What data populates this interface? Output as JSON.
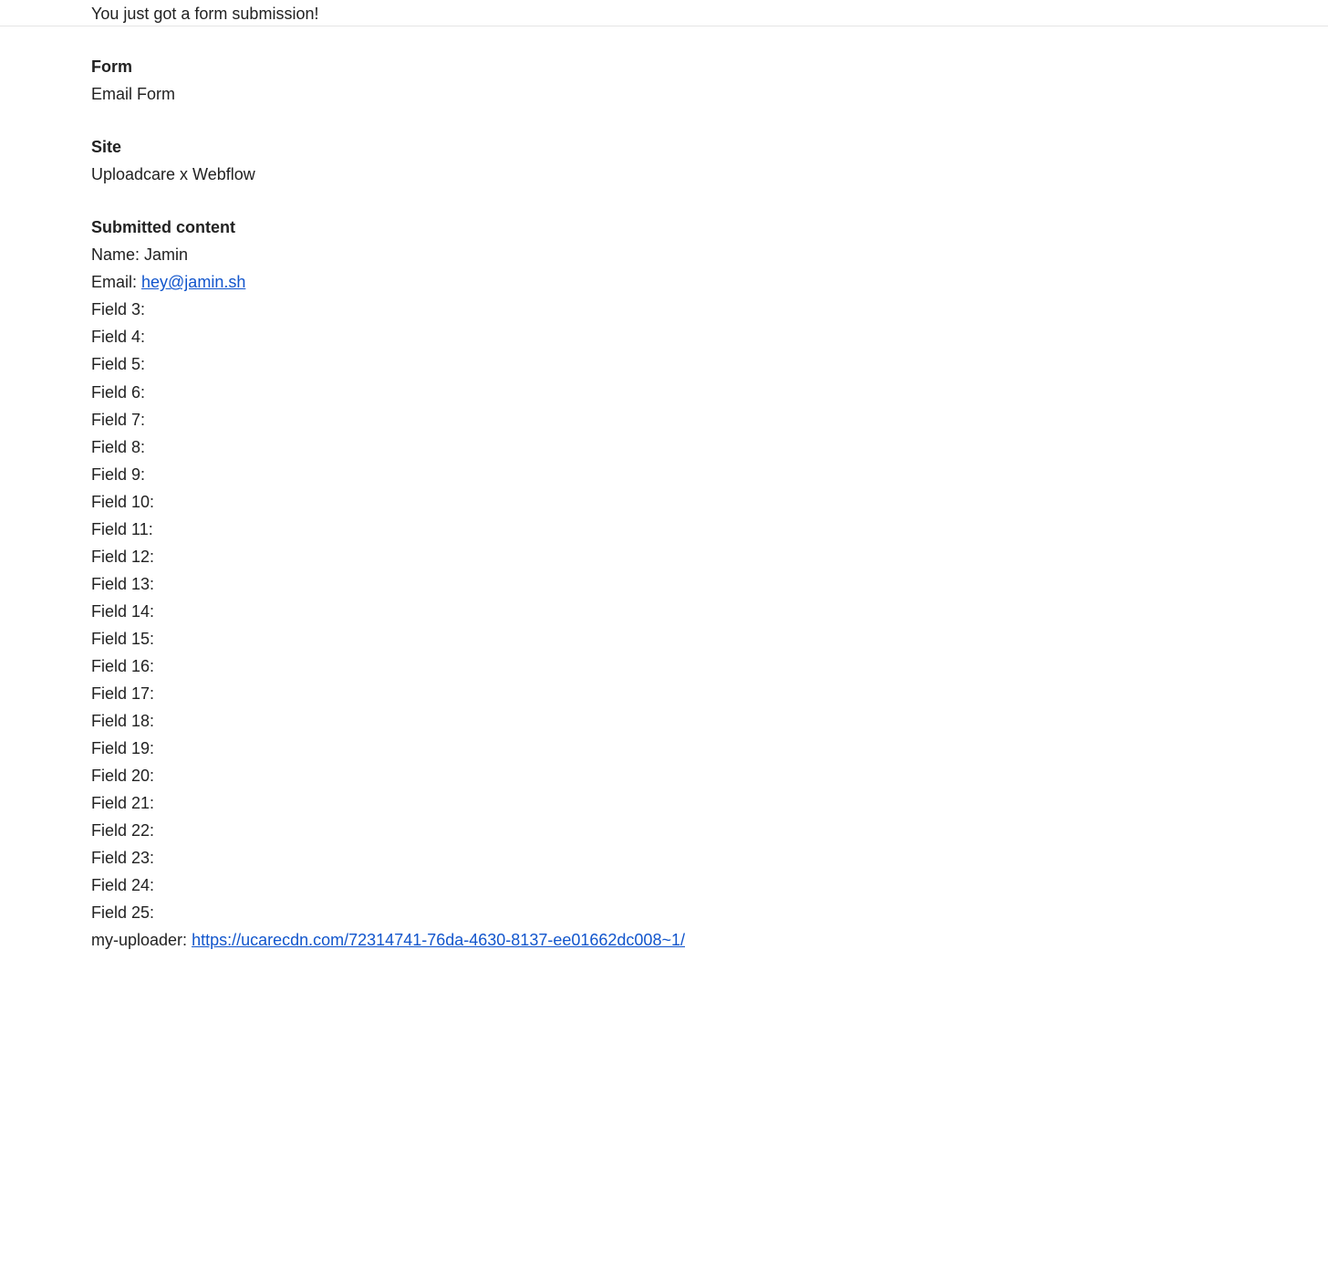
{
  "intro": "You just got a form submission!",
  "form": {
    "heading": "Form",
    "value": "Email Form"
  },
  "site": {
    "heading": "Site",
    "value": "Uploadcare x Webflow"
  },
  "submitted": {
    "heading": "Submitted content",
    "fields": [
      {
        "label": "Name: ",
        "value": "Jamin",
        "is_link": false
      },
      {
        "label": "Email: ",
        "value": "hey@jamin.sh",
        "is_link": true
      },
      {
        "label": "Field 3: ",
        "value": "",
        "is_link": false
      },
      {
        "label": "Field 4: ",
        "value": "",
        "is_link": false
      },
      {
        "label": "Field 5: ",
        "value": "",
        "is_link": false
      },
      {
        "label": "Field 6: ",
        "value": "",
        "is_link": false
      },
      {
        "label": "Field 7: ",
        "value": "",
        "is_link": false
      },
      {
        "label": "Field 8: ",
        "value": "",
        "is_link": false
      },
      {
        "label": "Field 9: ",
        "value": "",
        "is_link": false
      },
      {
        "label": "Field 10: ",
        "value": "",
        "is_link": false
      },
      {
        "label": "Field 11: ",
        "value": "",
        "is_link": false
      },
      {
        "label": "Field 12: ",
        "value": "",
        "is_link": false
      },
      {
        "label": "Field 13: ",
        "value": "",
        "is_link": false
      },
      {
        "label": "Field 14: ",
        "value": "",
        "is_link": false
      },
      {
        "label": "Field 15: ",
        "value": "",
        "is_link": false
      },
      {
        "label": "Field 16: ",
        "value": "",
        "is_link": false
      },
      {
        "label": "Field 17: ",
        "value": "",
        "is_link": false
      },
      {
        "label": "Field 18: ",
        "value": "",
        "is_link": false
      },
      {
        "label": "Field 19: ",
        "value": "",
        "is_link": false
      },
      {
        "label": "Field 20: ",
        "value": "",
        "is_link": false
      },
      {
        "label": "Field 21: ",
        "value": "",
        "is_link": false
      },
      {
        "label": "Field 22: ",
        "value": "",
        "is_link": false
      },
      {
        "label": "Field 23: ",
        "value": "",
        "is_link": false
      },
      {
        "label": "Field 24: ",
        "value": "",
        "is_link": false
      },
      {
        "label": "Field 25: ",
        "value": "",
        "is_link": false
      },
      {
        "label": "my-uploader: ",
        "value": "https://ucarecdn.com/72314741-76da-4630-8137-ee01662dc008~1/",
        "is_link": true
      }
    ]
  }
}
